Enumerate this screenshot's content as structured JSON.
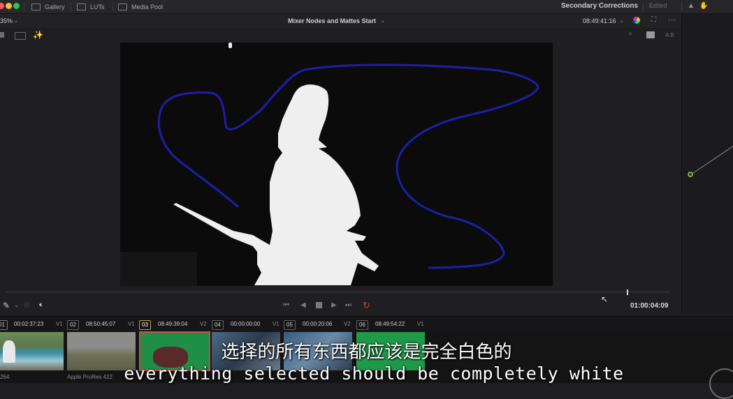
{
  "window": {
    "tabs": [
      {
        "label": "Gallery",
        "icon": "gallery-icon"
      },
      {
        "label": "LUTs",
        "icon": "luts-icon"
      },
      {
        "label": "Media Pool",
        "icon": "media-pool-icon"
      }
    ],
    "node_panel_title": "Secondary Corrections",
    "node_panel_status": "Edited",
    "colors": {
      "close": "#fe5f57",
      "minimize": "#febc2e",
      "maximize": "#28c840"
    }
  },
  "viewer": {
    "zoom": "35%",
    "title": "Mixer Nodes and Mattes Start",
    "source_timecode": "08:49:41:16",
    "ab_label": "A B",
    "playhead_timecode": "01:00:04:09",
    "transport": [
      "skip-back",
      "step-back",
      "stop",
      "play",
      "skip-forward",
      "loop"
    ]
  },
  "clips": [
    {
      "num": "01",
      "tc": "00:02:37:23",
      "track": "V1",
      "codec": "264"
    },
    {
      "num": "02",
      "tc": "08:50:45:07",
      "track": "V1",
      "codec": "Apple ProRes 422"
    },
    {
      "num": "03",
      "tc": "08:49:39:04",
      "track": "V2",
      "codec": ""
    },
    {
      "num": "04",
      "tc": "00:00:00:00",
      "track": "V1",
      "codec": ""
    },
    {
      "num": "05",
      "tc": "00:00:20:06",
      "track": "V2",
      "codec": ""
    },
    {
      "num": "06",
      "tc": "08:49:54:22",
      "track": "V1",
      "codec": ""
    }
  ],
  "subtitle": {
    "chinese": "选择的所有东西都应该是完全白色的",
    "english": "everything selected should be completely white"
  }
}
